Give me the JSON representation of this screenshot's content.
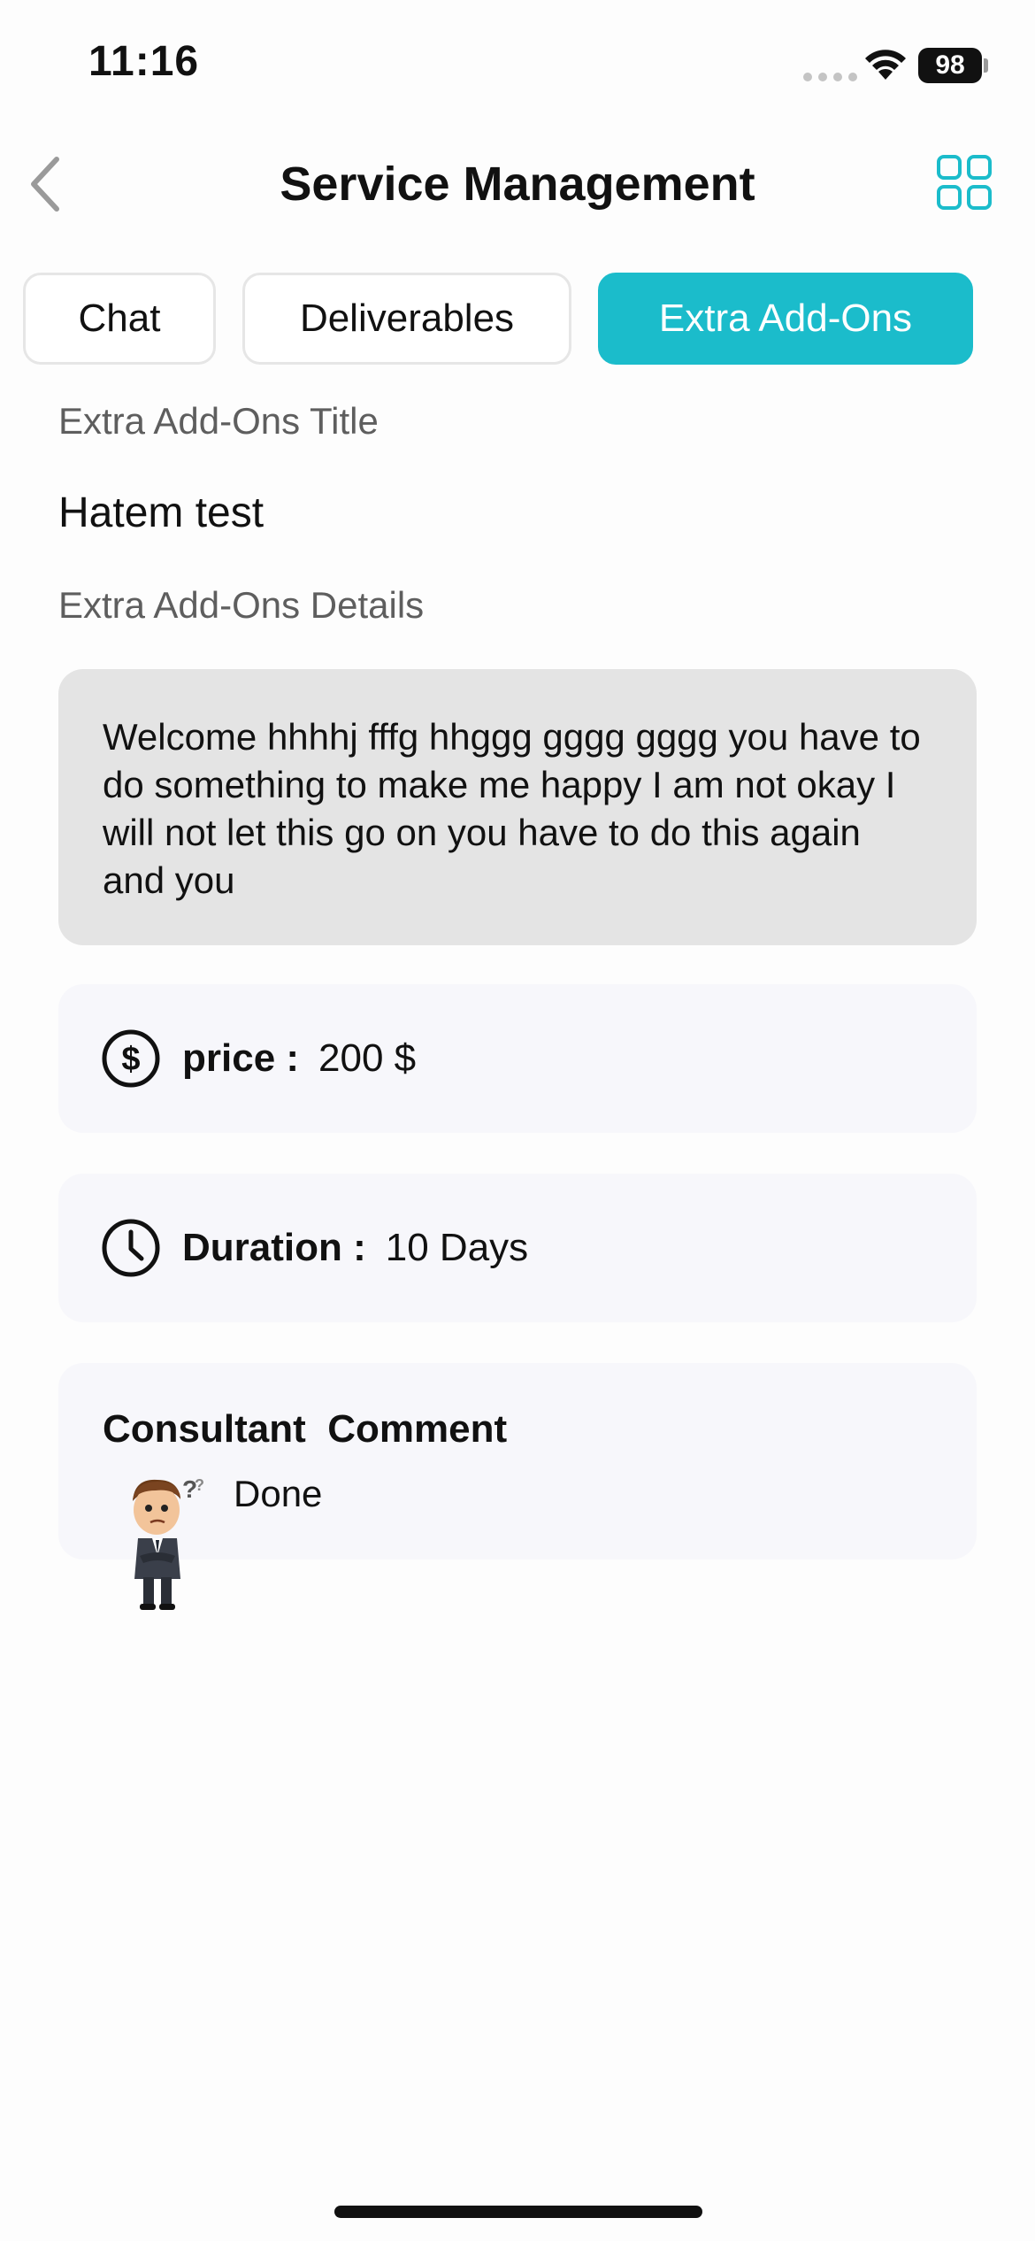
{
  "status_bar": {
    "time": "11:16",
    "battery": "98"
  },
  "header": {
    "title": "Service Management"
  },
  "tabs": [
    {
      "label": "Chat",
      "active": false
    },
    {
      "label": "Deliverables",
      "active": false
    },
    {
      "label": "Extra Add-Ons",
      "active": true
    }
  ],
  "addon": {
    "title_label": "Extra Add-Ons Title",
    "title_value": "Hatem test",
    "details_label": "Extra Add-Ons Details",
    "details_text": "Welcome hhhhj fffg hhggg gggg gggg you have to do something to make me happy I am not okay I will not let this go on you have to do this again and you",
    "price_label": "price :",
    "price_value": "200 $",
    "duration_label": "Duration :",
    "duration_value": "10 Days"
  },
  "comment": {
    "title": "Consultant  Comment",
    "text": "Done"
  },
  "colors": {
    "accent": "#1bbccb",
    "card_bg": "#f7f7fb",
    "details_bg": "#e4e4e4"
  }
}
